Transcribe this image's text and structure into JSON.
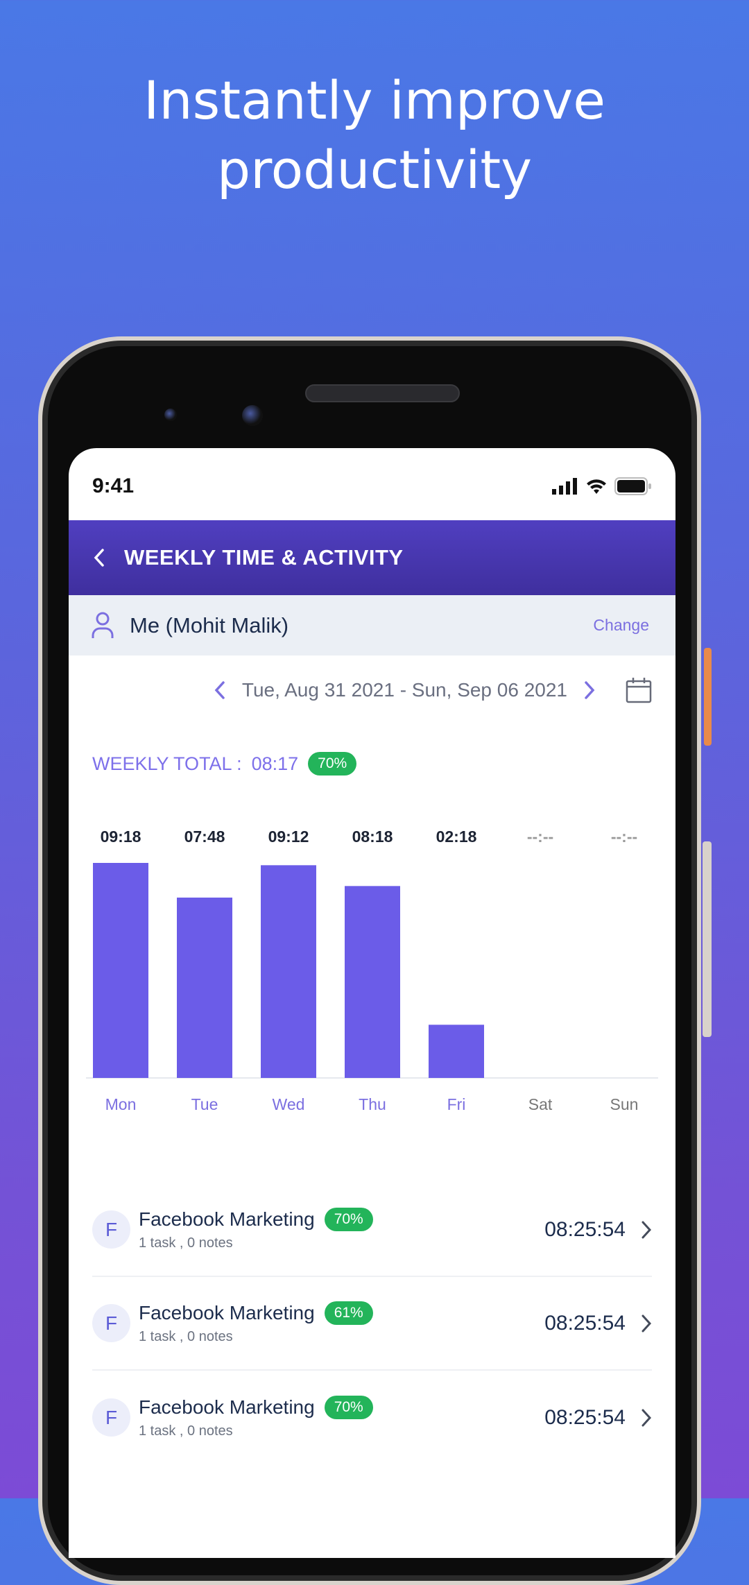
{
  "headline": {
    "line1": "Instantly improve",
    "line2": "productivity"
  },
  "status_bar": {
    "time": "9:41",
    "icons": [
      "signal-icon",
      "wifi-icon",
      "battery-icon"
    ]
  },
  "app_bar": {
    "title": "WEEKLY TIME & ACTIVITY",
    "back_icon": "chevron-left-icon"
  },
  "user": {
    "name": "Me (Mohit Malik)",
    "change_label": "Change",
    "icon": "user-icon"
  },
  "date_range": {
    "label": "Tue, Aug 31 2021 - Sun, Sep 06 2021"
  },
  "weekly_total": {
    "label": "WEEKLY TOTAL :",
    "value": "08:17",
    "percent": "70%"
  },
  "colors": {
    "accent": "#6c5ce7",
    "bar": "#6b5ce8",
    "badge": "#23b45a",
    "header": "#4a3ab5"
  },
  "chart_data": {
    "type": "bar",
    "categories": [
      "Mon",
      "Tue",
      "Wed",
      "Thu",
      "Fri",
      "Sat",
      "Sun"
    ],
    "value_labels": [
      "09:18",
      "07:48",
      "09:12",
      "08:18",
      "02:18",
      "--:--",
      "--:--"
    ],
    "values": [
      9.3,
      7.8,
      9.2,
      8.3,
      2.3,
      null,
      null
    ],
    "grid": false
  },
  "activities": [
    {
      "initial": "F",
      "name": "Facebook Marketing",
      "percent": "70%",
      "sub": "1 task , 0 notes",
      "time": "08:25:54"
    },
    {
      "initial": "F",
      "name": "Facebook Marketing",
      "percent": "61%",
      "sub": "1 task , 0 notes",
      "time": "08:25:54"
    },
    {
      "initial": "F",
      "name": "Facebook Marketing",
      "percent": "70%",
      "sub": "1 task , 0 notes",
      "time": "08:25:54"
    }
  ]
}
